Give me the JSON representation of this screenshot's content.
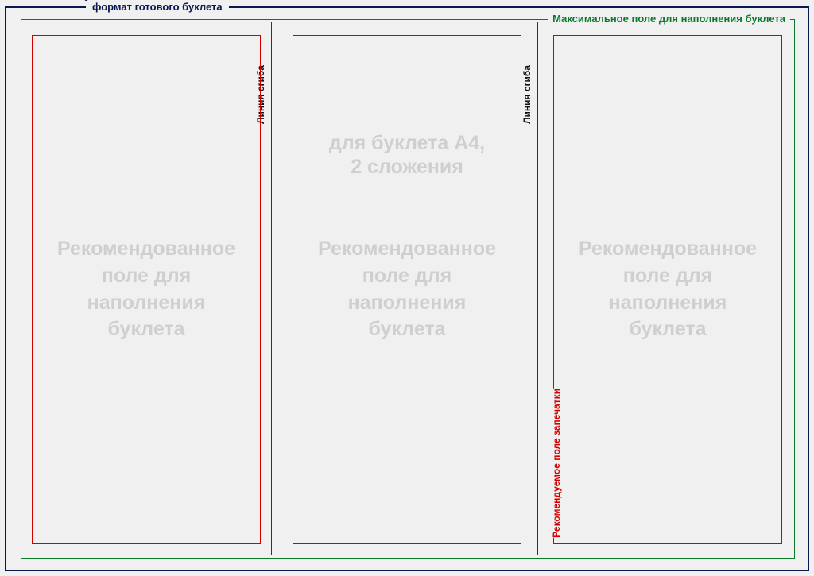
{
  "labels": {
    "outer_frame": "формат готового буклета",
    "inner_frame": "Максимальное поле для наполнения буклета",
    "fold_line": "Линия сгиба",
    "print_area": "Рекомендуемое поле запечатки",
    "panel_recommended": "Рекомендованное\nполе для\nнаполнения\nбуклета",
    "center_subtitle": "для буклета А4,\n2 сложения"
  },
  "layout": {
    "format": "A4",
    "folds": 2,
    "panels": 3
  }
}
